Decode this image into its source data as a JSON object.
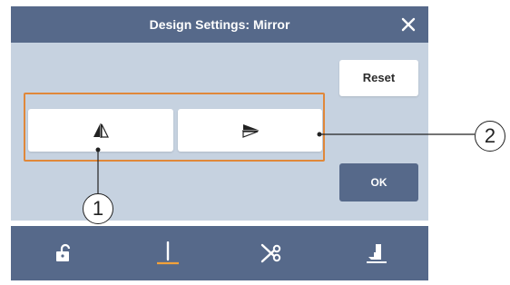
{
  "dialog": {
    "title": "Design Settings: Mirror",
    "close_icon": "close-icon",
    "reset_label": "Reset",
    "ok_label": "OK",
    "mirror_buttons": [
      {
        "icon": "mirror-horizontal-icon"
      },
      {
        "icon": "mirror-vertical-icon"
      }
    ]
  },
  "callouts": [
    {
      "label": "1"
    },
    {
      "label": "2"
    }
  ],
  "bottom_tabs": [
    {
      "icon": "unlock-icon"
    },
    {
      "icon": "needle-icon",
      "active": true
    },
    {
      "icon": "scissors-icon"
    },
    {
      "icon": "presser-foot-icon"
    }
  ],
  "colors": {
    "header": "#56698a",
    "panel": "#c6d2e0",
    "highlight": "#e0883a",
    "active_tab": "#f2a23a"
  }
}
